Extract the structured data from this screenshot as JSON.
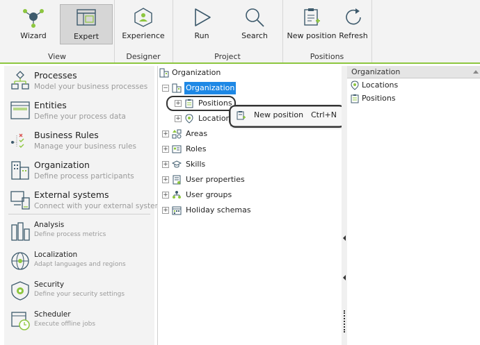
{
  "ribbon": {
    "groups": {
      "view": "View",
      "designer": "Designer",
      "project": "Project",
      "positions": "Positions"
    },
    "buttons": {
      "wizard": "Wizard",
      "expert": "Expert",
      "experience": "Experience",
      "run": "Run",
      "search": "Search",
      "new_position": "New position",
      "refresh": "Refresh"
    }
  },
  "sidebar": {
    "items": [
      {
        "title": "Processes",
        "subtitle": "Model your business processes"
      },
      {
        "title": "Entities",
        "subtitle": "Define your process data"
      },
      {
        "title": "Business Rules",
        "subtitle": "Manage your business rules"
      },
      {
        "title": "Organization",
        "subtitle": "Define process participants"
      },
      {
        "title": "External systems",
        "subtitle": "Connect with your external systems"
      },
      {
        "title": "Analysis",
        "subtitle": "Define process metrics"
      },
      {
        "title": "Localization",
        "subtitle": "Adapt languages and regions"
      },
      {
        "title": "Security",
        "subtitle": "Define your security settings"
      },
      {
        "title": "Scheduler",
        "subtitle": "Execute offline jobs"
      }
    ]
  },
  "tree": {
    "root": "Organization",
    "selected": "Organization",
    "children_of_selected": [
      "Positions",
      "Locations"
    ],
    "nodes": [
      "Areas",
      "Roles",
      "Skills",
      "User properties",
      "User groups",
      "Holiday schemas"
    ]
  },
  "context_menu": {
    "label": "New position",
    "shortcut": "Ctrl+N"
  },
  "right_panel": {
    "header": "Organization",
    "items": [
      "Locations",
      "Positions"
    ]
  }
}
